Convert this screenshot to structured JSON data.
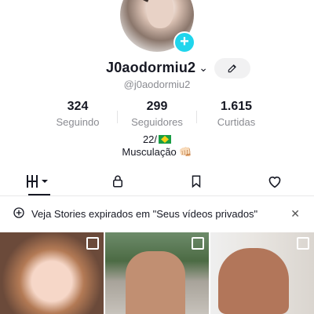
{
  "profile": {
    "username": "J0aodormiu2",
    "handle": "@j0aodormiu2",
    "add_icon": "+",
    "stats": [
      {
        "value": "324",
        "label": "Seguindo"
      },
      {
        "value": "299",
        "label": "Seguidores"
      },
      {
        "value": "1.615",
        "label": "Curtidas"
      }
    ],
    "bio_line1": "22/",
    "bio_line2": "Musculação 👊🏻"
  },
  "tabs": [
    {
      "icon": "grid-icon",
      "active": true
    },
    {
      "icon": "lock-icon"
    },
    {
      "icon": "bookmark-icon"
    },
    {
      "icon": "heart-icon"
    }
  ],
  "banner": {
    "text": "Veja Stories expirados em \"Seus vídeos privados\"",
    "close": "✕"
  }
}
